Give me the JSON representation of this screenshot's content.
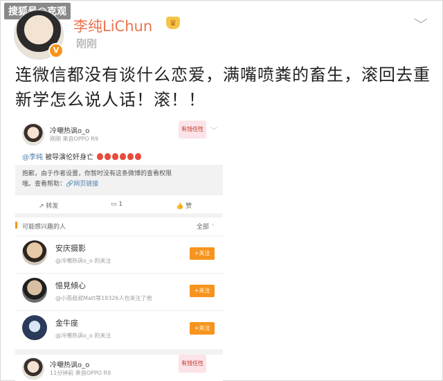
{
  "watermark": "搜狐号@克观",
  "post": {
    "author": "李纯LiChun",
    "time": "刚刚",
    "text": "连微信都没有谈什么恋爱，满嘴喷粪的畜生，滚回去重新学怎么说人话！滚！！"
  },
  "embedded": {
    "author": "冷嘲热讽o_o",
    "meta": "刚刚  来自OPPO R9",
    "badge": "有钱任性",
    "mention": "@李纯",
    "body": "被导演伦奸身亡",
    "notice_line1": "抱歉，由于作者设置，你暂时没有这条微博的查看权限",
    "notice_line2": "哦。查看帮助：",
    "notice_link": "网页链接",
    "actions": {
      "repost": "转发",
      "comment": "1",
      "like": "赞"
    },
    "suggestions_title": "可能感兴趣的人",
    "suggestions_all": "全部",
    "suggestions": [
      {
        "name": "安庆摄影",
        "sub": "@冷嘲热讽o_o 的关注",
        "button": "+关注"
      },
      {
        "name": "憶見傾心",
        "sub": "@小雨叔叔Matt等18326人也关注了他",
        "button": "+关注"
      },
      {
        "name": "金牛座",
        "sub": "@冷嘲热讽o_o 的关注",
        "button": "+关注"
      }
    ],
    "author2": "冷嘲热讽o_o",
    "meta2": "11分钟前  来自OPPO R9"
  }
}
